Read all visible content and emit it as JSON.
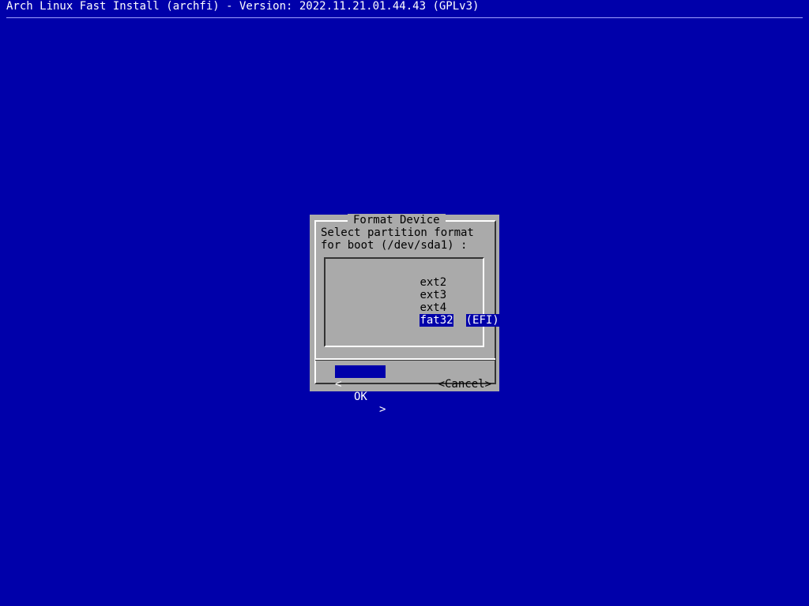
{
  "backtitle": "Arch Linux Fast Install (archfi) - Version: 2022.11.21.01.44.43 (GPLv3)",
  "dialog": {
    "title": "Format Device",
    "prompt_line1": "Select partition format",
    "prompt_line2": "for boot (/dev/sda1) :",
    "items": [
      {
        "tag": "ext2",
        "desc": ""
      },
      {
        "tag": "ext3",
        "desc": ""
      },
      {
        "tag": "ext4",
        "desc": ""
      },
      {
        "tag": "fat32",
        "desc": "(EFI)"
      }
    ],
    "selected_index": 3,
    "buttons": {
      "ok": {
        "left": "<",
        "label": "OK",
        "right": ">"
      },
      "cancel": {
        "label": "<Cancel>"
      }
    }
  },
  "colors": {
    "background": "#0000aa",
    "dialog": "#aaaaaa",
    "highlight": "#0000aa",
    "text": "#000000"
  }
}
